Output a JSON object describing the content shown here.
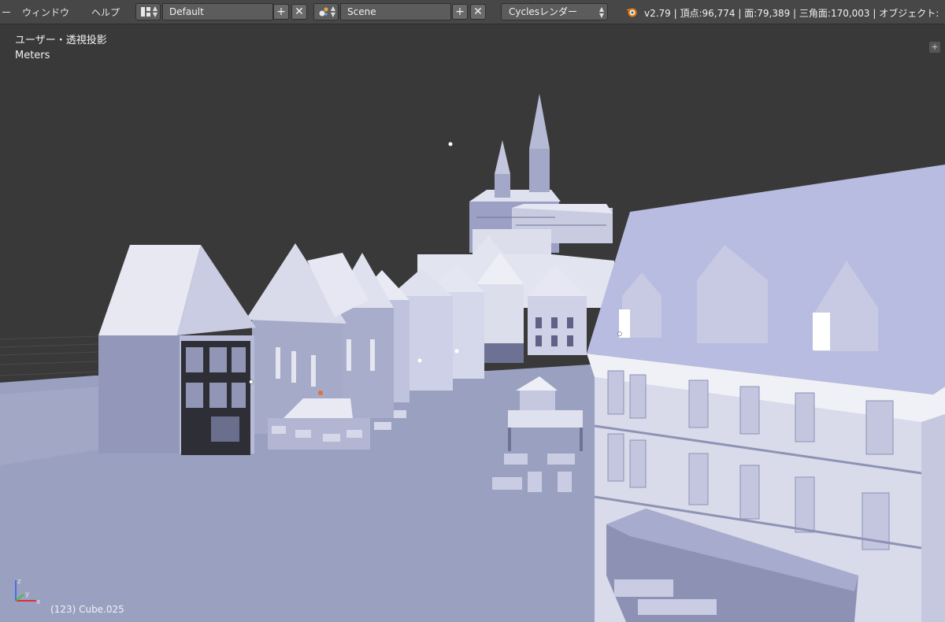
{
  "header": {
    "menus": [
      {
        "label": "ー"
      },
      {
        "label": "ウィンドウ"
      },
      {
        "label": "ヘルプ"
      }
    ],
    "screen_layout": "Default",
    "scene_name": "Scene",
    "render_engine": "Cyclesレンダー",
    "stats": "v2.79 | 頂点:96,774 | 面:79,389 | 三角面:170,003 | オブジェクト:"
  },
  "viewport": {
    "view_name": "ユーザー・透視投影",
    "units": "Meters",
    "selected_object": "(123) Cube.025",
    "axis_labels": {
      "z": "z",
      "y": "y",
      "x": "x"
    }
  },
  "colors": {
    "header_bg": "#474747",
    "viewport_bg": "#393939",
    "ground": "#9aa0c0",
    "building_light": "#dfe1ee",
    "building_mid": "#a9adc9",
    "building_dark": "#7f84a4",
    "timber_dark": "#2e2f36"
  }
}
